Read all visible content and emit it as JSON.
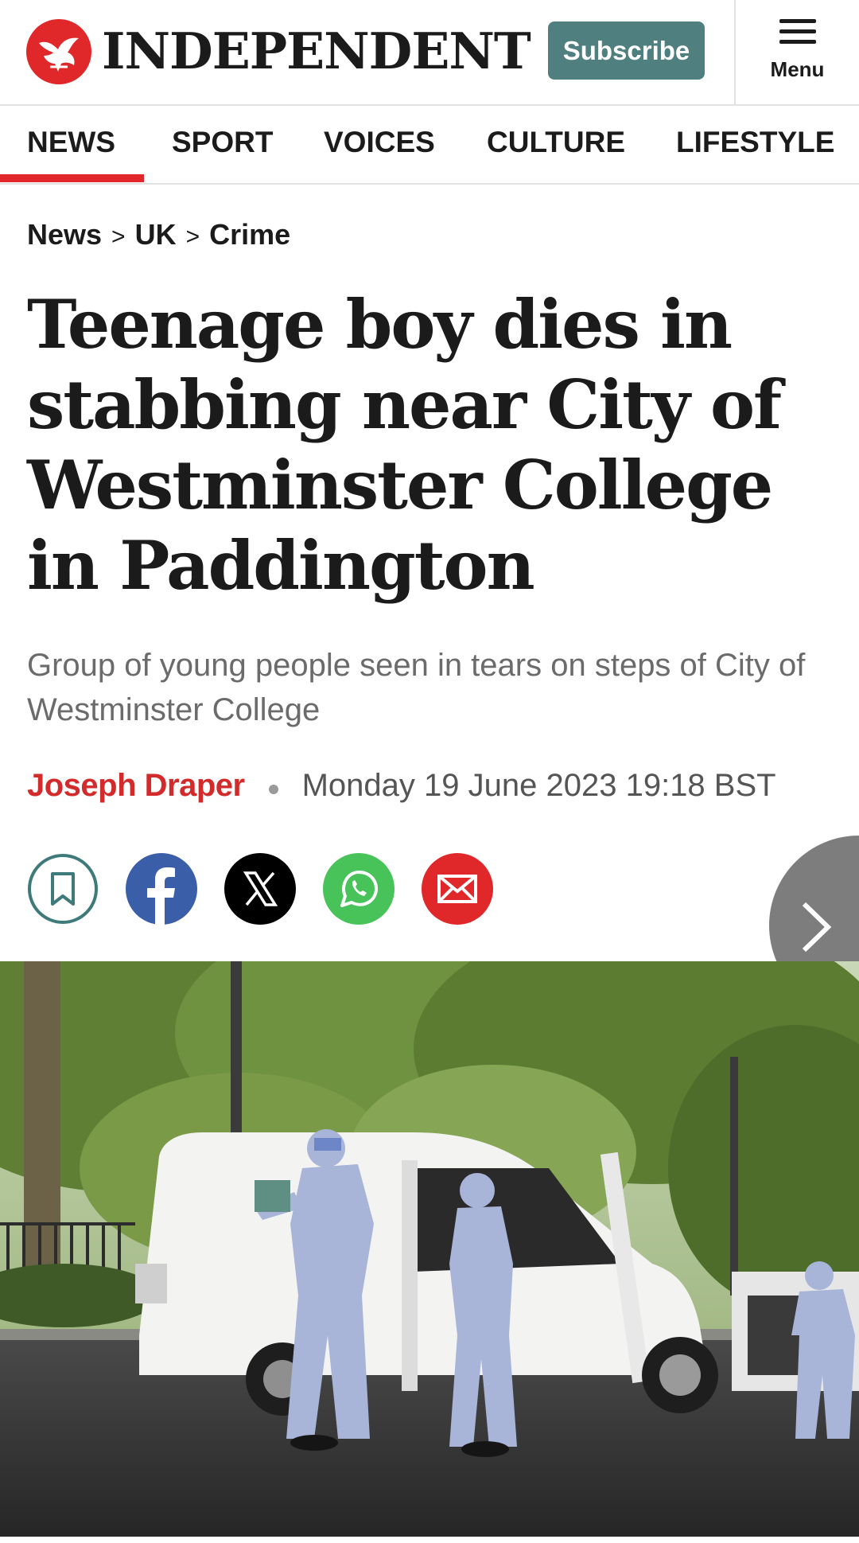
{
  "header": {
    "brand": "INDEPENDENT",
    "subscribe_label": "Subscribe",
    "menu_label": "Menu"
  },
  "nav": {
    "items": [
      {
        "label": "NEWS",
        "active": true
      },
      {
        "label": "SPORT",
        "active": false
      },
      {
        "label": "VOICES",
        "active": false
      },
      {
        "label": "CULTURE",
        "active": false
      },
      {
        "label": "LIFESTYLE",
        "active": false
      }
    ]
  },
  "breadcrumb": {
    "items": [
      "News",
      "UK",
      "Crime"
    ],
    "separator": ">"
  },
  "article": {
    "headline": "Teenage boy dies in stabbing near City of Westminster College in Paddington",
    "standfirst": "Group of young people seen in tears on steps of City of Westminster College",
    "author": "Joseph Draper",
    "date": "Monday 19 June 2023 19:18 BST"
  },
  "share": {
    "buttons": [
      {
        "name": "bookmark-icon",
        "color": "#3f7a7a"
      },
      {
        "name": "facebook-icon",
        "color": "#3b5ea8"
      },
      {
        "name": "x-icon",
        "color": "#000000"
      },
      {
        "name": "whatsapp-icon",
        "color": "#48c35a"
      },
      {
        "name": "email-icon",
        "color": "#e0282a"
      }
    ]
  },
  "colors": {
    "brand_red": "#e0282a",
    "subscribe_teal": "#4f7f7f",
    "author_red": "#d32b2b"
  }
}
